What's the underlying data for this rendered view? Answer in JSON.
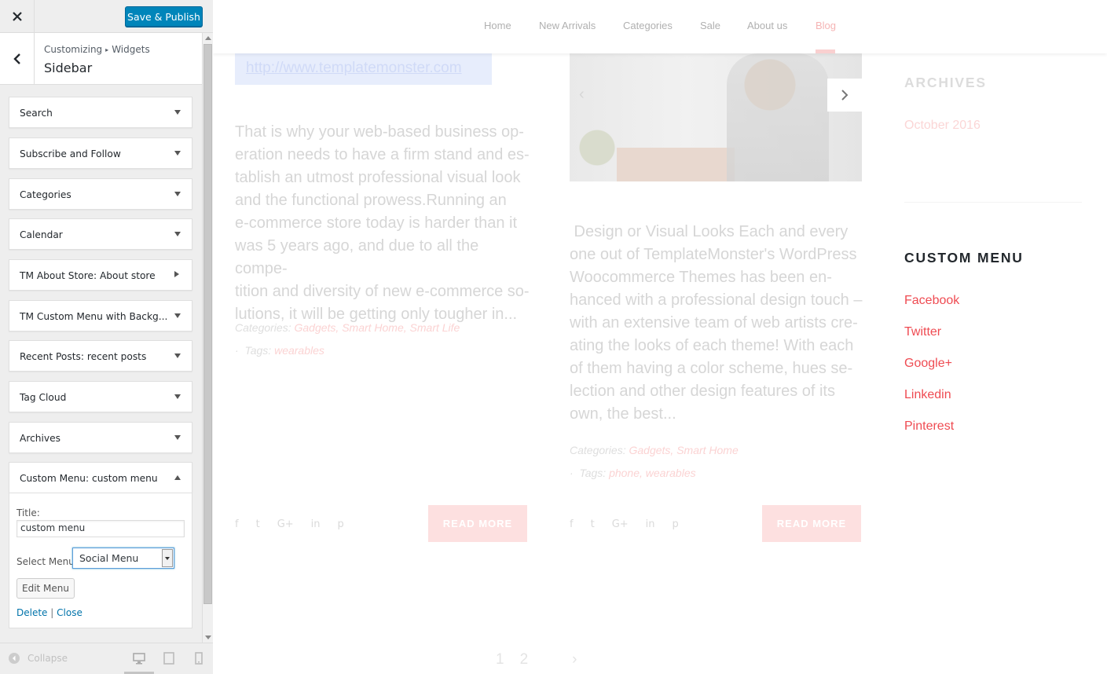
{
  "header": {
    "close_icon": "close-icon",
    "save_label": "Save & Publish"
  },
  "section": {
    "breadcrumb_parent": "Customizing",
    "breadcrumb_separator": "▸",
    "breadcrumb_child": "Widgets",
    "title": "Sidebar"
  },
  "widgets": [
    {
      "title": "Search",
      "sub": ""
    },
    {
      "title": "Subscribe and Follow",
      "sub": ""
    },
    {
      "title": "Categories",
      "sub": ""
    },
    {
      "title": "Calendar",
      "sub": ""
    },
    {
      "title": "TM About Store",
      "sub": "About store"
    },
    {
      "title": "TM Custom Menu with Backg...",
      "sub": ""
    },
    {
      "title": "Recent Posts",
      "sub": "recent posts"
    },
    {
      "title": "Tag Cloud",
      "sub": ""
    },
    {
      "title": "Archives",
      "sub": ""
    },
    {
      "title": "Custom Menu",
      "sub": "custom menu"
    }
  ],
  "widget_form": {
    "title_label": "Title:",
    "title_value": "custom menu",
    "select_label": "Select Menu:",
    "select_value": "Social Menu",
    "edit_button": "Edit Menu",
    "delete_link": "Delete",
    "link_separator": "|",
    "close_link": "Close"
  },
  "footer": {
    "collapse_label": "Collapse",
    "devices": [
      "desktop-icon",
      "tablet-icon",
      "mobile-icon"
    ]
  },
  "preview": {
    "nav": [
      "Home",
      "New Arrivals",
      "Categories",
      "Sale",
      "About us",
      "Blog"
    ],
    "nav_active": "Blog",
    "link_url": "http://www.templatemonster.com",
    "post1": {
      "lines": [
        "That is why your web-based business op-",
        "eration needs to have a firm stand and es-",
        "tablish an utmost professional visual look",
        "and the functional prowess.Running an",
        "e-commerce store today is harder than it",
        "was 5 years ago, and due to all the compe-",
        "tition and diversity of new e-commerce so-",
        "lutions, it will be getting only tougher in..."
      ],
      "categories_label": "Categories:",
      "categories": "Gadgets, Smart Home, Smart Life",
      "tags_label": "Tags:",
      "tags": "wearables",
      "read_more": "READ MORE"
    },
    "post2": {
      "lines": [
        " Design or Visual Looks Each and every",
        "one out of TemplateMonster's WordPress",
        "Woocommerce Themes has been en-",
        "hanced with a professional design touch –",
        "with an extensive team of web artists cre-",
        "ating the looks of each theme! With each",
        "of them having a color scheme, hues se-",
        "lection and other design features of its",
        "own, the best..."
      ],
      "categories_label": "Categories:",
      "categories": "Gadgets, Smart Home",
      "tags_label": "Tags:",
      "tags": "phone, wearables",
      "read_more": "READ MORE"
    },
    "social_icons": [
      "f",
      "t",
      "G+",
      "in",
      "p"
    ],
    "sidebar": {
      "archives_heading": "ARCHIVES",
      "archives_item": "October 2016",
      "custom_menu_heading": "CUSTOM MENU",
      "menu_links": [
        "Facebook",
        "Twitter",
        "Google+",
        "Linkedin",
        "Pinterest"
      ]
    },
    "pager": [
      "1",
      "2",
      "›"
    ]
  },
  "colors": {
    "accent": "#0085ba",
    "menu_link": "#ef4b52"
  }
}
